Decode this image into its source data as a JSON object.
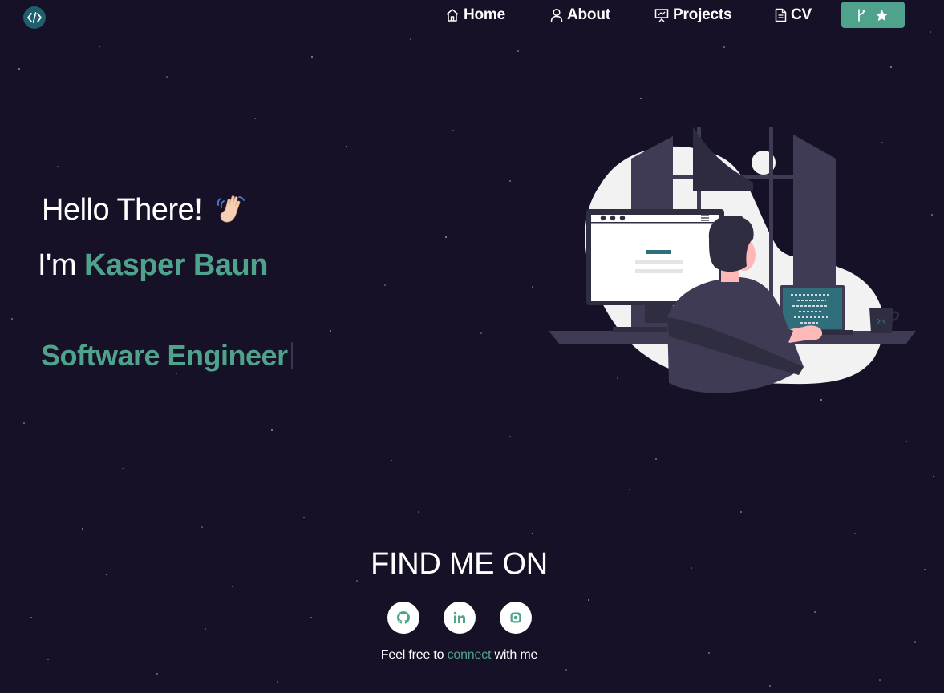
{
  "nav": {
    "items": [
      {
        "label": "Home",
        "icon": "home-icon"
      },
      {
        "label": "About",
        "icon": "user-icon"
      },
      {
        "label": "Projects",
        "icon": "presentation-icon"
      },
      {
        "label": "CV",
        "icon": "document-icon"
      }
    ],
    "fork_button": {
      "icons": [
        "git-fork-icon",
        "star-icon"
      ]
    }
  },
  "hero": {
    "greeting": "Hello There!",
    "intro_prefix": "I'm",
    "name": "Kasper Baun",
    "role": "Software Engineer"
  },
  "social": {
    "title": "FIND ME ON",
    "links": [
      {
        "icon": "github-icon"
      },
      {
        "icon": "linkedin-icon"
      },
      {
        "icon": "instagram-icon"
      }
    ],
    "footer_prefix": "Feel free to",
    "footer_highlight": "connect",
    "footer_suffix": "with me"
  },
  "colors": {
    "background": "#161126",
    "accent": "#4fa38c",
    "logo_bg": "#1f5f6e"
  }
}
